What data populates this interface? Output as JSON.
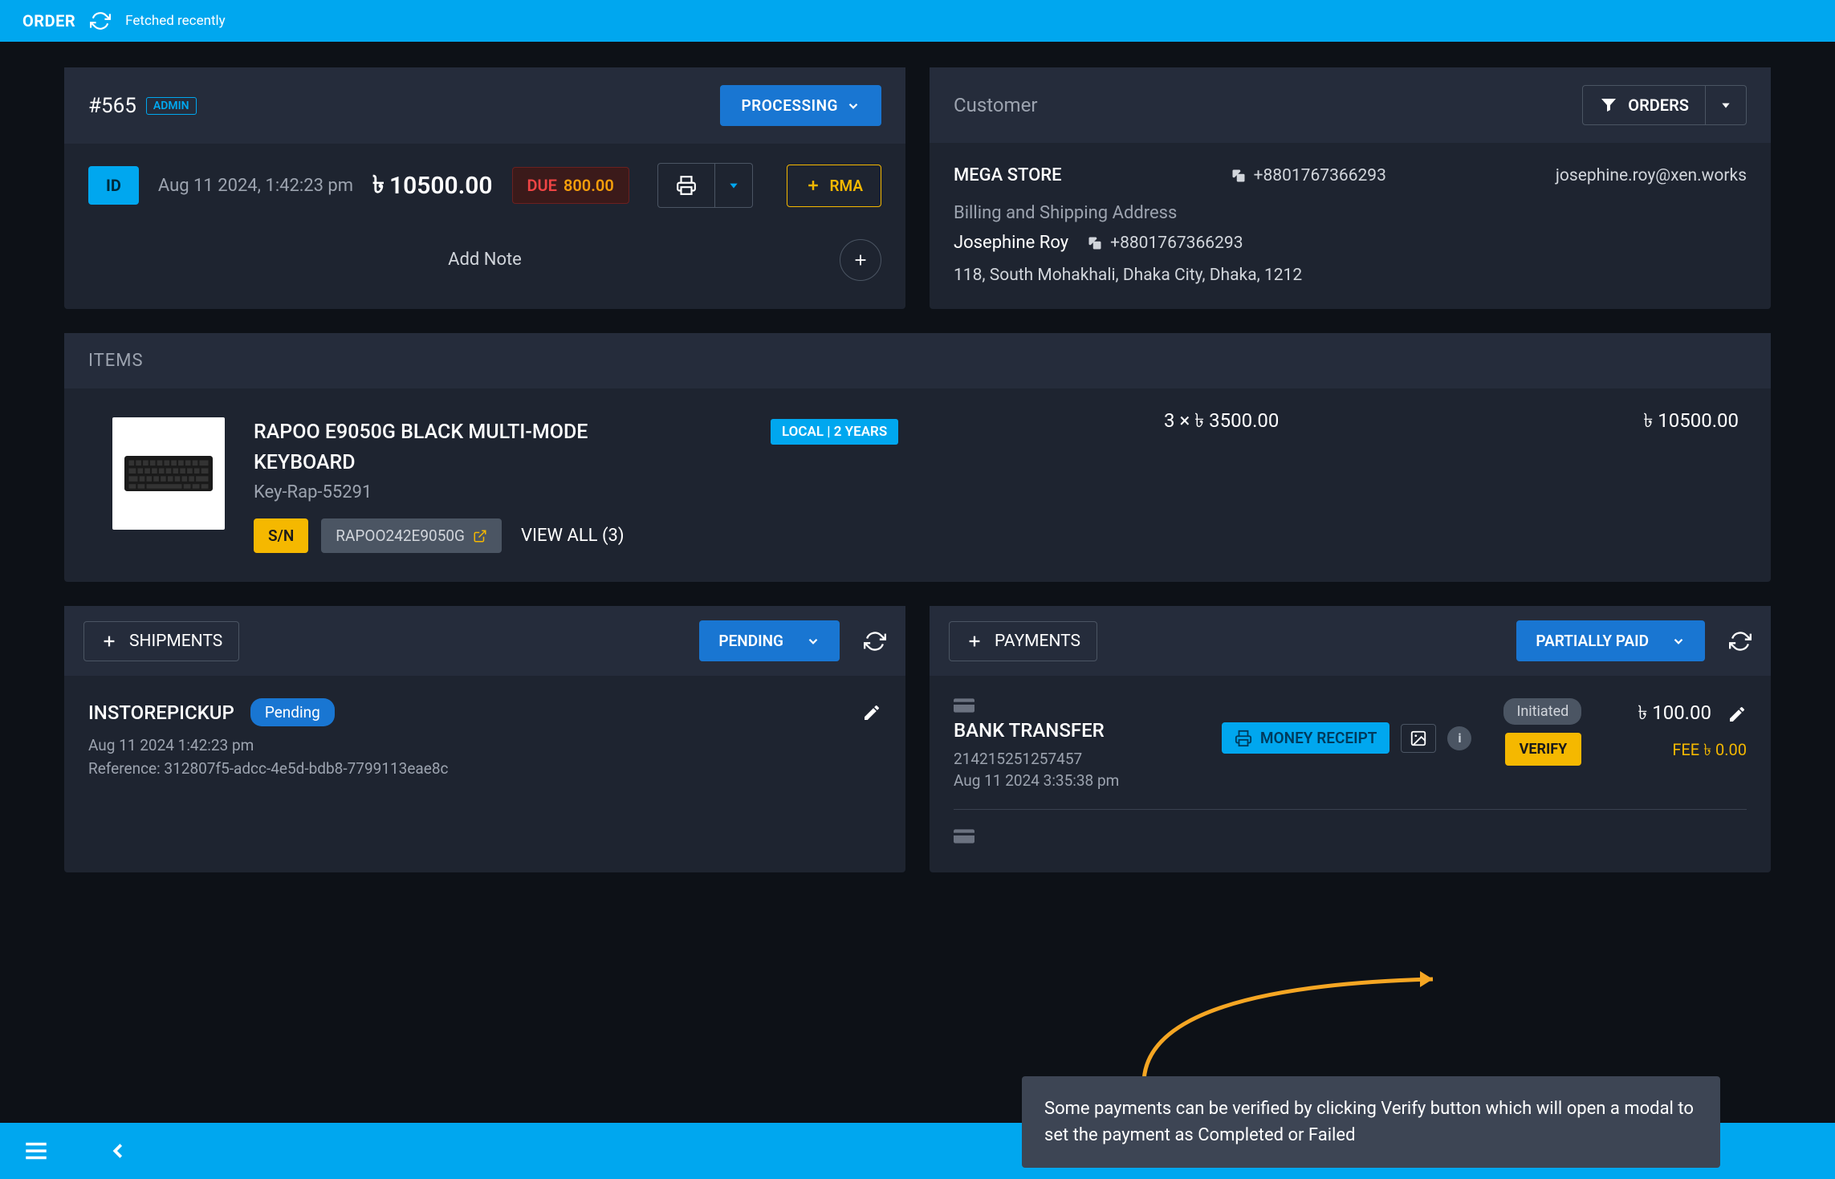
{
  "topBar": {
    "title": "ORDER",
    "fetched": "Fetched recently"
  },
  "order": {
    "number": "#565",
    "adminBadge": "ADMIN",
    "statusBtn": "PROCESSING",
    "idBadge": "ID",
    "date": "Aug 11 2024, 1:42:23 pm",
    "total": "10500.00",
    "dueLabel": "DUE",
    "dueValue": "800.00",
    "rmaBtn": "RMA",
    "noteLabel": "Add Note"
  },
  "customer": {
    "header": "Customer",
    "ordersBtn": "ORDERS",
    "store": "MEGA STORE",
    "phone": "+8801767366293",
    "email": "josephine.roy@xen.works",
    "addrLabel": "Billing and Shipping Address",
    "name": "Josephine Roy",
    "phone2": "+8801767366293",
    "address": "118, South Mohakhali, Dhaka City, Dhaka, 1212"
  },
  "items": {
    "header": "ITEMS",
    "name": "RAPOO E9050G BLACK MULTI-MODE KEYBOARD",
    "sku": "Key-Rap-55291",
    "warranty": "LOCAL | 2 YEARS",
    "snBadge": "S/N",
    "serial": "RAPOO242E9050G",
    "viewAll": "VIEW ALL (3)",
    "qtyPrice": "3 × ৳ 3500.00",
    "lineTotal": "৳ 10500.00"
  },
  "shipments": {
    "addBtn": "SHIPMENTS",
    "statusBtn": "PENDING",
    "method": "INSTOREPICKUP",
    "pill": "Pending",
    "date": "Aug 11 2024 1:42:23 pm",
    "refLabel": "Reference: 312807f5-adcc-4e5d-bdb8-7799113eae8c"
  },
  "payments": {
    "addBtn": "PAYMENTS",
    "statusBtn": "PARTIALLY PAID",
    "method": "BANK TRANSFER",
    "ref": "214215251257457",
    "date": "Aug 11 2024 3:35:38 pm",
    "receiptBtn": "MONEY RECEIPT",
    "initiatedPill": "Initiated",
    "verifyBtn": "VERIFY",
    "amount": "৳ 100.00",
    "feeLabel": "FEE ৳ 0.00"
  },
  "tooltip": "Some payments can be verified by clicking Verify button which will open a modal to set the payment as Completed or Failed"
}
